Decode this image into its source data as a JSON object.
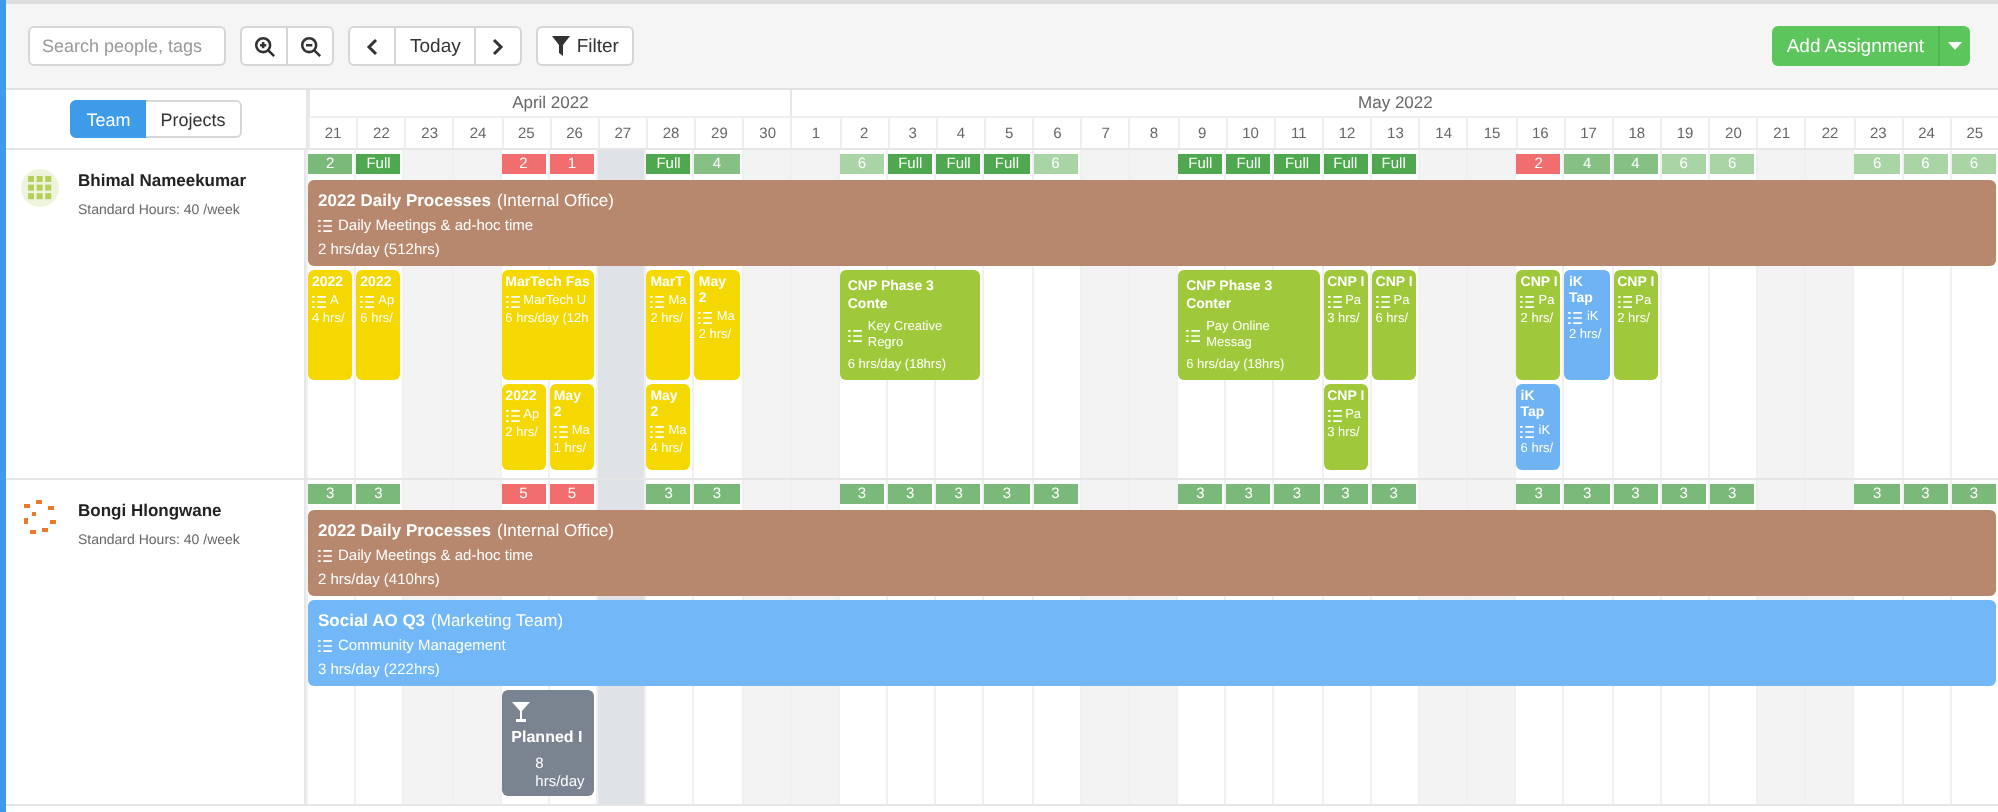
{
  "toolbar": {
    "search": {
      "placeholder": "Search people, tags"
    },
    "today_button": "Today",
    "filter_button": "Filter",
    "add_button": "Add Assignment"
  },
  "view_tabs": [
    {
      "label": "Team",
      "selected": true
    },
    {
      "label": "Projects",
      "selected": false
    }
  ],
  "months": [
    {
      "label": "April 2022",
      "days": [
        {
          "label": "21",
          "weekend": false,
          "today": false
        },
        {
          "label": "22",
          "weekend": false,
          "today": false
        },
        {
          "label": "23",
          "weekend": true,
          "today": false
        },
        {
          "label": "24",
          "weekend": true,
          "today": false
        },
        {
          "label": "25",
          "weekend": false,
          "today": false
        },
        {
          "label": "26",
          "weekend": false,
          "today": false
        },
        {
          "label": "27",
          "weekend": false,
          "today": true
        },
        {
          "label": "28",
          "weekend": false,
          "today": false
        },
        {
          "label": "29",
          "weekend": false,
          "today": false
        },
        {
          "label": "30",
          "weekend": true,
          "today": false
        }
      ]
    },
    {
      "label": "May 2022",
      "days": [
        {
          "label": "1",
          "weekend": true,
          "today": false
        },
        {
          "label": "2",
          "weekend": false,
          "today": false
        },
        {
          "label": "3",
          "weekend": false,
          "today": false
        },
        {
          "label": "4",
          "weekend": false,
          "today": false
        },
        {
          "label": "5",
          "weekend": false,
          "today": false
        },
        {
          "label": "6",
          "weekend": false,
          "today": false
        },
        {
          "label": "7",
          "weekend": true,
          "today": false
        },
        {
          "label": "8",
          "weekend": true,
          "today": false
        },
        {
          "label": "9",
          "weekend": false,
          "today": false
        },
        {
          "label": "10",
          "weekend": false,
          "today": false
        },
        {
          "label": "11",
          "weekend": false,
          "today": false
        },
        {
          "label": "12",
          "weekend": false,
          "today": false
        },
        {
          "label": "13",
          "weekend": false,
          "today": false
        },
        {
          "label": "14",
          "weekend": true,
          "today": false
        },
        {
          "label": "15",
          "weekend": true,
          "today": false
        },
        {
          "label": "16",
          "weekend": false,
          "today": false
        },
        {
          "label": "17",
          "weekend": false,
          "today": false
        },
        {
          "label": "18",
          "weekend": false,
          "today": false
        },
        {
          "label": "19",
          "weekend": false,
          "today": false
        },
        {
          "label": "20",
          "weekend": false,
          "today": false
        },
        {
          "label": "21",
          "weekend": true,
          "today": false
        },
        {
          "label": "22",
          "weekend": true,
          "today": false
        },
        {
          "label": "23",
          "weekend": false,
          "today": false
        },
        {
          "label": "24",
          "weekend": false,
          "today": false
        },
        {
          "label": "25",
          "weekend": false,
          "today": false
        }
      ]
    }
  ],
  "people": [
    {
      "name": "Bhimal Nameekumar",
      "hours": "Standard Hours: 40 /week",
      "capacity": [
        {
          "kind": "load",
          "text": "2",
          "color": "#7bb97b"
        },
        {
          "kind": "load",
          "text": "Full",
          "color": "#4fa84f"
        },
        {
          "kind": "none"
        },
        {
          "kind": "none"
        },
        {
          "kind": "load",
          "text": "2",
          "color": "#f26d6d"
        },
        {
          "kind": "load",
          "text": "1",
          "color": "#f26d6d"
        },
        {
          "kind": "none"
        },
        {
          "kind": "load",
          "text": "Full",
          "color": "#4fa84f"
        },
        {
          "kind": "load",
          "text": "4",
          "color": "#86c084"
        },
        {
          "kind": "none"
        },
        {
          "kind": "none"
        },
        {
          "kind": "load",
          "text": "6",
          "color": "#a9d5a6"
        },
        {
          "kind": "load",
          "text": "Full",
          "color": "#4fa84f"
        },
        {
          "kind": "load",
          "text": "Full",
          "color": "#4fa84f"
        },
        {
          "kind": "load",
          "text": "Full",
          "color": "#4fa84f"
        },
        {
          "kind": "load",
          "text": "6",
          "color": "#a9d5a6"
        },
        {
          "kind": "none"
        },
        {
          "kind": "none"
        },
        {
          "kind": "load",
          "text": "Full",
          "color": "#4fa84f"
        },
        {
          "kind": "load",
          "text": "Full",
          "color": "#4fa84f"
        },
        {
          "kind": "load",
          "text": "Full",
          "color": "#4fa84f"
        },
        {
          "kind": "load",
          "text": "Full",
          "color": "#4fa84f"
        },
        {
          "kind": "load",
          "text": "Full",
          "color": "#4fa84f"
        },
        {
          "kind": "none"
        },
        {
          "kind": "none"
        },
        {
          "kind": "load",
          "text": "2",
          "color": "#f26d6d"
        },
        {
          "kind": "load",
          "text": "4",
          "color": "#86c084"
        },
        {
          "kind": "load",
          "text": "4",
          "color": "#86c084"
        },
        {
          "kind": "load",
          "text": "6",
          "color": "#a9d5a6"
        },
        {
          "kind": "load",
          "text": "6",
          "color": "#a9d5a6"
        },
        {
          "kind": "none"
        },
        {
          "kind": "none"
        },
        {
          "kind": "load",
          "text": "6",
          "color": "#a9d5a6"
        },
        {
          "kind": "load",
          "text": "6",
          "color": "#a9d5a6"
        },
        {
          "kind": "load",
          "text": "6",
          "color": "#a9d5a6"
        }
      ],
      "lanes": [
        [
          {
            "kind": "project",
            "title": "2022 Daily Processes",
            "client": "(Internal Office)",
            "task": "Daily Meetings & ad-hoc time",
            "hours": "2 hrs/day (512hrs)",
            "color": "#b8886e"
          },
          {
            "kind": "more"
          },
          {
            "kind": "more"
          },
          {
            "kind": "more"
          },
          {
            "kind": "more"
          },
          {
            "kind": "more"
          },
          {
            "kind": "more"
          },
          {
            "kind": "more"
          },
          {
            "kind": "more"
          },
          {
            "kind": "more"
          },
          {
            "kind": "more"
          },
          {
            "kind": "more"
          },
          {
            "kind": "more"
          },
          {
            "kind": "more"
          },
          {
            "kind": "more"
          },
          {
            "kind": "more"
          },
          {
            "kind": "more"
          },
          {
            "kind": "more"
          },
          {
            "kind": "more"
          },
          {
            "kind": "more"
          },
          {
            "kind": "more"
          },
          {
            "kind": "more"
          },
          {
            "kind": "more"
          },
          {
            "kind": "more"
          },
          {
            "kind": "more"
          },
          {
            "kind": "more"
          },
          {
            "kind": "more"
          },
          {
            "kind": "more"
          },
          {
            "kind": "more"
          },
          {
            "kind": "more"
          },
          {
            "kind": "more"
          },
          {
            "kind": "more"
          },
          {
            "kind": "more"
          },
          {
            "kind": "more"
          },
          {
            "kind": "more"
          }
        ],
        [
          {
            "kind": "project",
            "title": "2022",
            "task": "A",
            "hours": "4 hrs/",
            "color": "#f5d800"
          },
          {
            "kind": "project",
            "title": "2022",
            "task": "Ap",
            "hours": "6 hrs/",
            "color": "#f5d800"
          },
          {
            "kind": "gap"
          },
          {
            "kind": "gap"
          },
          {
            "kind": "project",
            "title": "MarTech Fas",
            "task": "MarTech U",
            "hours": "6 hrs/day (12h",
            "color": "#f5d800"
          },
          {
            "kind": "more"
          },
          {
            "kind": "gap"
          },
          {
            "kind": "project",
            "title": "MarT",
            "task": "Ma",
            "hours": "2 hrs/",
            "color": "#f5d800"
          },
          {
            "kind": "project",
            "title": "May 2",
            "task": "Ma",
            "hours": "2 hrs/",
            "color": "#f5d800"
          },
          {
            "kind": "gap"
          },
          {
            "kind": "gap"
          },
          {
            "kind": "project",
            "title": "CNP Phase 3 Conte",
            "task": "Key Creative Regro",
            "hours": "6 hrs/day (18hrs)",
            "color": "#9fc93a"
          },
          {
            "kind": "more"
          },
          {
            "kind": "more"
          },
          {
            "kind": "gap"
          },
          {
            "kind": "gap"
          },
          {
            "kind": "gap"
          },
          {
            "kind": "gap"
          },
          {
            "kind": "project",
            "title": "CNP Phase 3 Conter",
            "task": "Pay Online Messag",
            "hours": "6 hrs/day (18hrs)",
            "color": "#9fc93a"
          },
          {
            "kind": "more"
          },
          {
            "kind": "more"
          },
          {
            "kind": "project",
            "title": "CNP I",
            "task": "Pa",
            "hours": "3 hrs/",
            "color": "#9fc93a"
          },
          {
            "kind": "project",
            "title": "CNP I",
            "task": "Pa",
            "hours": "6 hrs/",
            "color": "#9fc93a"
          },
          {
            "kind": "gap"
          },
          {
            "kind": "gap"
          },
          {
            "kind": "project",
            "title": "CNP I",
            "task": "Pa",
            "hours": "2 hrs/",
            "color": "#9fc93a"
          },
          {
            "kind": "project",
            "title": "iK Tap",
            "task": "iK",
            "hours": "2 hrs/",
            "color": "#6fb3f5"
          },
          {
            "kind": "project",
            "title": "CNP I",
            "task": "Pa",
            "hours": "2 hrs/",
            "color": "#9fc93a"
          },
          {
            "kind": "gap"
          },
          {
            "kind": "gap"
          },
          {
            "kind": "gap"
          },
          {
            "kind": "gap"
          },
          {
            "kind": "gap"
          },
          {
            "kind": "gap"
          },
          {
            "kind": "gap"
          }
        ],
        [
          {
            "kind": "gap"
          },
          {
            "kind": "gap"
          },
          {
            "kind": "gap"
          },
          {
            "kind": "gap"
          },
          {
            "kind": "project",
            "title": "2022",
            "task": "Ap",
            "hours": "2 hrs/",
            "color": "#f5d800"
          },
          {
            "kind": "project",
            "title": "May 2",
            "task": "Ma",
            "hours": "1 hrs/",
            "color": "#f5d800"
          },
          {
            "kind": "gap"
          },
          {
            "kind": "project",
            "title": "May 2",
            "task": "Ma",
            "hours": "4 hrs/",
            "color": "#f5d800"
          },
          {
            "kind": "gap"
          },
          {
            "kind": "gap"
          },
          {
            "kind": "gap"
          },
          {
            "kind": "gap"
          },
          {
            "kind": "gap"
          },
          {
            "kind": "gap"
          },
          {
            "kind": "gap"
          },
          {
            "kind": "gap"
          },
          {
            "kind": "gap"
          },
          {
            "kind": "gap"
          },
          {
            "kind": "gap"
          },
          {
            "kind": "gap"
          },
          {
            "kind": "gap"
          },
          {
            "kind": "project",
            "title": "CNP I",
            "task": "Pa",
            "hours": "3 hrs/",
            "color": "#9fc93a"
          },
          {
            "kind": "gap"
          },
          {
            "kind": "gap"
          },
          {
            "kind": "gap"
          },
          {
            "kind": "project",
            "title": "iK Tap",
            "task": "iK",
            "hours": "6 hrs/",
            "color": "#6fb3f5"
          },
          {
            "kind": "gap"
          },
          {
            "kind": "gap"
          },
          {
            "kind": "gap"
          },
          {
            "kind": "gap"
          },
          {
            "kind": "gap"
          },
          {
            "kind": "gap"
          },
          {
            "kind": "gap"
          },
          {
            "kind": "gap"
          },
          {
            "kind": "gap"
          }
        ]
      ]
    },
    {
      "name": "Bongi Hlongwane",
      "hours": "Standard Hours: 40 /week",
      "capacity": [
        {
          "kind": "load",
          "text": "3",
          "color": "#7bb97b"
        },
        {
          "kind": "load",
          "text": "3",
          "color": "#7bb97b"
        },
        {
          "kind": "none"
        },
        {
          "kind": "none"
        },
        {
          "kind": "load",
          "text": "5",
          "color": "#f26d6d"
        },
        {
          "kind": "load",
          "text": "5",
          "color": "#f26d6d"
        },
        {
          "kind": "none"
        },
        {
          "kind": "load",
          "text": "3",
          "color": "#7bb97b"
        },
        {
          "kind": "load",
          "text": "3",
          "color": "#7bb97b"
        },
        {
          "kind": "none"
        },
        {
          "kind": "none"
        },
        {
          "kind": "load",
          "text": "3",
          "color": "#7bb97b"
        },
        {
          "kind": "load",
          "text": "3",
          "color": "#7bb97b"
        },
        {
          "kind": "load",
          "text": "3",
          "color": "#7bb97b"
        },
        {
          "kind": "load",
          "text": "3",
          "color": "#7bb97b"
        },
        {
          "kind": "load",
          "text": "3",
          "color": "#7bb97b"
        },
        {
          "kind": "none"
        },
        {
          "kind": "none"
        },
        {
          "kind": "load",
          "text": "3",
          "color": "#7bb97b"
        },
        {
          "kind": "load",
          "text": "3",
          "color": "#7bb97b"
        },
        {
          "kind": "load",
          "text": "3",
          "color": "#7bb97b"
        },
        {
          "kind": "load",
          "text": "3",
          "color": "#7bb97b"
        },
        {
          "kind": "load",
          "text": "3",
          "color": "#7bb97b"
        },
        {
          "kind": "none"
        },
        {
          "kind": "none"
        },
        {
          "kind": "load",
          "text": "3",
          "color": "#7bb97b"
        },
        {
          "kind": "load",
          "text": "3",
          "color": "#7bb97b"
        },
        {
          "kind": "load",
          "text": "3",
          "color": "#7bb97b"
        },
        {
          "kind": "load",
          "text": "3",
          "color": "#7bb97b"
        },
        {
          "kind": "load",
          "text": "3",
          "color": "#7bb97b"
        },
        {
          "kind": "none"
        },
        {
          "kind": "none"
        },
        {
          "kind": "load",
          "text": "3",
          "color": "#7bb97b"
        },
        {
          "kind": "load",
          "text": "3",
          "color": "#7bb97b"
        },
        {
          "kind": "load",
          "text": "3",
          "color": "#7bb97b"
        }
      ],
      "lanes": [
        [
          {
            "kind": "project",
            "title": "2022 Daily Processes",
            "client": "(Internal Office)",
            "task": "Daily Meetings & ad-hoc time",
            "hours": "2 hrs/day (410hrs)",
            "color": "#b8886e"
          },
          {
            "kind": "more"
          },
          {
            "kind": "more"
          },
          {
            "kind": "more"
          },
          {
            "kind": "more"
          },
          {
            "kind": "more"
          },
          {
            "kind": "more"
          },
          {
            "kind": "more"
          },
          {
            "kind": "more"
          },
          {
            "kind": "more"
          },
          {
            "kind": "more"
          },
          {
            "kind": "more"
          },
          {
            "kind": "more"
          },
          {
            "kind": "more"
          },
          {
            "kind": "more"
          },
          {
            "kind": "more"
          },
          {
            "kind": "more"
          },
          {
            "kind": "more"
          },
          {
            "kind": "more"
          },
          {
            "kind": "more"
          },
          {
            "kind": "more"
          },
          {
            "kind": "more"
          },
          {
            "kind": "more"
          },
          {
            "kind": "more"
          },
          {
            "kind": "more"
          },
          {
            "kind": "more"
          },
          {
            "kind": "more"
          },
          {
            "kind": "more"
          },
          {
            "kind": "more"
          },
          {
            "kind": "more"
          },
          {
            "kind": "more"
          },
          {
            "kind": "more"
          },
          {
            "kind": "more"
          },
          {
            "kind": "more"
          },
          {
            "kind": "more"
          }
        ],
        [
          {
            "kind": "project",
            "title": "Social AO Q3",
            "client": "(Marketing Team)",
            "task": "Community Management",
            "hours": "3 hrs/day (222hrs)",
            "color": "#72b8f8"
          },
          {
            "kind": "more"
          },
          {
            "kind": "more"
          },
          {
            "kind": "more"
          },
          {
            "kind": "more"
          },
          {
            "kind": "more"
          },
          {
            "kind": "more"
          },
          {
            "kind": "more"
          },
          {
            "kind": "more"
          },
          {
            "kind": "more"
          },
          {
            "kind": "more"
          },
          {
            "kind": "more"
          },
          {
            "kind": "more"
          },
          {
            "kind": "more"
          },
          {
            "kind": "more"
          },
          {
            "kind": "more"
          },
          {
            "kind": "more"
          },
          {
            "kind": "more"
          },
          {
            "kind": "more"
          },
          {
            "kind": "more"
          },
          {
            "kind": "more"
          },
          {
            "kind": "more"
          },
          {
            "kind": "more"
          },
          {
            "kind": "more"
          },
          {
            "kind": "more"
          },
          {
            "kind": "more"
          },
          {
            "kind": "more"
          },
          {
            "kind": "more"
          },
          {
            "kind": "more"
          },
          {
            "kind": "more"
          },
          {
            "kind": "more"
          },
          {
            "kind": "more"
          },
          {
            "kind": "more"
          },
          {
            "kind": "more"
          },
          {
            "kind": "more"
          }
        ],
        [
          {
            "kind": "gap"
          },
          {
            "kind": "gap"
          },
          {
            "kind": "gap"
          },
          {
            "kind": "gap"
          },
          {
            "kind": "leave",
            "title": "Planned I",
            "hours": "8 hrs/day",
            "color": "#7a8390"
          },
          {
            "kind": "more"
          },
          {
            "kind": "gap"
          },
          {
            "kind": "gap"
          },
          {
            "kind": "gap"
          },
          {
            "kind": "gap"
          },
          {
            "kind": "gap"
          },
          {
            "kind": "gap"
          },
          {
            "kind": "gap"
          },
          {
            "kind": "gap"
          },
          {
            "kind": "gap"
          },
          {
            "kind": "gap"
          },
          {
            "kind": "gap"
          },
          {
            "kind": "gap"
          },
          {
            "kind": "gap"
          },
          {
            "kind": "gap"
          },
          {
            "kind": "gap"
          },
          {
            "kind": "gap"
          },
          {
            "kind": "gap"
          },
          {
            "kind": "gap"
          },
          {
            "kind": "gap"
          },
          {
            "kind": "gap"
          },
          {
            "kind": "gap"
          },
          {
            "kind": "gap"
          },
          {
            "kind": "gap"
          },
          {
            "kind": "gap"
          },
          {
            "kind": "gap"
          },
          {
            "kind": "gap"
          },
          {
            "kind": "gap"
          },
          {
            "kind": "gap"
          },
          {
            "kind": "gap"
          }
        ]
      ]
    }
  ]
}
